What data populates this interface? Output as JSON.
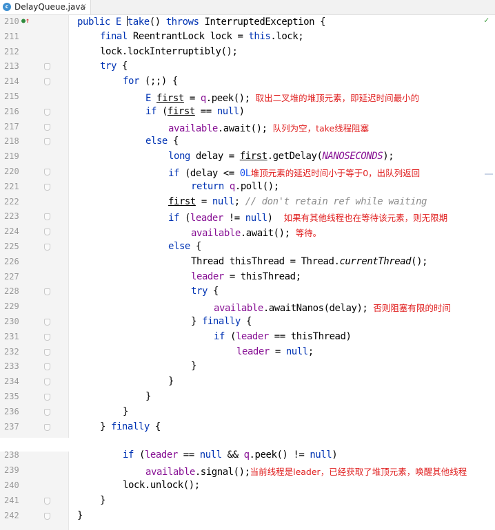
{
  "tab": {
    "filename": "DelayQueue.java",
    "close": "×",
    "icon": "class-icon",
    "icon_letter": "c"
  },
  "status": {
    "check": "✓"
  },
  "lines": [
    {
      "n": "210",
      "indent": 0,
      "mark": true,
      "segs": [
        [
          "kw",
          "public "
        ],
        [
          "kw",
          "E "
        ],
        [
          "cursor",
          ""
        ],
        [
          "kw",
          "take"
        ],
        [
          "",
          "() "
        ],
        [
          "kw",
          "throws "
        ],
        [
          "",
          "InterruptedException {"
        ]
      ]
    },
    {
      "n": "211",
      "indent": 1,
      "segs": [
        [
          "kw",
          "final "
        ],
        [
          "",
          "ReentrantLock lock = "
        ],
        [
          "kw",
          "this"
        ],
        [
          "",
          ".lock;"
        ]
      ]
    },
    {
      "n": "212",
      "indent": 1,
      "segs": [
        [
          "",
          "lock.lockInterruptibly();"
        ]
      ]
    },
    {
      "n": "213",
      "indent": 1,
      "fold": true,
      "segs": [
        [
          "kw",
          "try "
        ],
        [
          "",
          "{"
        ]
      ]
    },
    {
      "n": "214",
      "indent": 2,
      "fold": true,
      "segs": [
        [
          "kw",
          "for "
        ],
        [
          "",
          "(;;) {"
        ]
      ]
    },
    {
      "n": "215",
      "indent": 3,
      "segs": [
        [
          "kw",
          "E "
        ],
        [
          "ul",
          "first"
        ],
        [
          "",
          " = "
        ],
        [
          "fld",
          "q"
        ],
        [
          "",
          ".peek(); "
        ],
        [
          "ann",
          "取出二叉堆的堆顶元素，即延迟时间最小的"
        ]
      ]
    },
    {
      "n": "216",
      "indent": 3,
      "fold": true,
      "segs": [
        [
          "kw",
          "if "
        ],
        [
          "",
          "("
        ],
        [
          "ul",
          "first"
        ],
        [
          "",
          " == "
        ],
        [
          "kw",
          "null"
        ],
        [
          "",
          ")"
        ]
      ]
    },
    {
      "n": "217",
      "indent": 4,
      "fold": true,
      "segs": [
        [
          "fld",
          "available"
        ],
        [
          "",
          ".await(); "
        ],
        [
          "ann",
          "队列为空，take线程阻塞"
        ]
      ]
    },
    {
      "n": "218",
      "indent": 3,
      "fold": true,
      "segs": [
        [
          "kw",
          "else "
        ],
        [
          "",
          "{"
        ]
      ]
    },
    {
      "n": "219",
      "indent": 4,
      "segs": [
        [
          "kw",
          "long "
        ],
        [
          "",
          "delay = "
        ],
        [
          "ul",
          "first"
        ],
        [
          "",
          ".getDelay("
        ],
        [
          "cst",
          "NANOSECONDS"
        ],
        [
          "",
          ");"
        ]
      ]
    },
    {
      "n": "220",
      "indent": 4,
      "fold": true,
      "segs": [
        [
          "kw",
          "if "
        ],
        [
          "",
          "(delay <= "
        ],
        [
          "num",
          "0L"
        ],
        [
          ") "
        ],
        [
          "ann",
          "堆顶元素的延迟时间小于等于0，出队列返回"
        ]
      ]
    },
    {
      "n": "221",
      "indent": 5,
      "fold": true,
      "segs": [
        [
          "kw",
          "return "
        ],
        [
          "fld",
          "q"
        ],
        [
          "",
          ".poll();"
        ]
      ]
    },
    {
      "n": "222",
      "indent": 4,
      "segs": [
        [
          "ul",
          "first"
        ],
        [
          "",
          " = "
        ],
        [
          "kw",
          "null"
        ],
        [
          "",
          "; "
        ],
        [
          "cmt",
          "// don't retain ref while waiting"
        ]
      ]
    },
    {
      "n": "223",
      "indent": 4,
      "fold": true,
      "segs": [
        [
          "kw",
          "if "
        ],
        [
          "",
          "("
        ],
        [
          "fld",
          "leader"
        ],
        [
          "",
          " != "
        ],
        [
          "kw",
          "null"
        ],
        [
          "",
          ")  "
        ],
        [
          "ann",
          "如果有其他线程也在等待该元素，则无限期"
        ]
      ]
    },
    {
      "n": "224",
      "indent": 5,
      "fold": true,
      "segs": [
        [
          "fld",
          "available"
        ],
        [
          "",
          ".await(); "
        ],
        [
          "ann",
          "等待。"
        ]
      ]
    },
    {
      "n": "225",
      "indent": 4,
      "fold": true,
      "segs": [
        [
          "kw",
          "else "
        ],
        [
          "",
          "{"
        ]
      ]
    },
    {
      "n": "226",
      "indent": 5,
      "segs": [
        [
          "",
          "Thread thisThread = Thread."
        ],
        [
          "ital",
          "currentThread"
        ],
        [
          "",
          "();"
        ]
      ]
    },
    {
      "n": "227",
      "indent": 5,
      "segs": [
        [
          "fld",
          "leader"
        ],
        [
          "",
          " = thisThread;"
        ]
      ]
    },
    {
      "n": "228",
      "indent": 5,
      "fold": true,
      "segs": [
        [
          "kw",
          "try "
        ],
        [
          "",
          "{"
        ]
      ]
    },
    {
      "n": "229",
      "indent": 6,
      "segs": [
        [
          "fld",
          "available"
        ],
        [
          "",
          ".awaitNanos(delay); "
        ],
        [
          "ann",
          "否则阻塞有限的时间"
        ]
      ]
    },
    {
      "n": "230",
      "indent": 5,
      "fold": true,
      "segs": [
        [
          "",
          "} "
        ],
        [
          "kw",
          "finally "
        ],
        [
          "",
          "{"
        ]
      ]
    },
    {
      "n": "231",
      "indent": 6,
      "fold": true,
      "segs": [
        [
          "kw",
          "if "
        ],
        [
          "",
          "("
        ],
        [
          "fld",
          "leader"
        ],
        [
          "",
          " == thisThread)"
        ]
      ]
    },
    {
      "n": "232",
      "indent": 7,
      "fold": true,
      "segs": [
        [
          "fld",
          "leader"
        ],
        [
          "",
          " = "
        ],
        [
          "kw",
          "null"
        ],
        [
          "",
          ";"
        ]
      ]
    },
    {
      "n": "233",
      "indent": 5,
      "fold": true,
      "segs": [
        [
          "",
          "}"
        ]
      ]
    },
    {
      "n": "234",
      "indent": 4,
      "fold": true,
      "segs": [
        [
          "",
          "}"
        ]
      ]
    },
    {
      "n": "235",
      "indent": 3,
      "fold": true,
      "segs": [
        [
          "",
          "}"
        ]
      ]
    },
    {
      "n": "236",
      "indent": 2,
      "fold": true,
      "segs": [
        [
          "",
          "}"
        ]
      ]
    },
    {
      "n": "237",
      "indent": 1,
      "fold": true,
      "segs": [
        [
          "",
          "} "
        ],
        [
          "kw",
          "finally "
        ],
        [
          "",
          "{"
        ]
      ]
    },
    {
      "n": "238",
      "indent": 2,
      "gap": true,
      "segs": [
        [
          "kw",
          "if "
        ],
        [
          "",
          "("
        ],
        [
          "fld",
          "leader"
        ],
        [
          "",
          " == "
        ],
        [
          "kw",
          "null "
        ],
        [
          "",
          "&& "
        ],
        [
          "fld",
          "q"
        ],
        [
          "",
          ".peek() != "
        ],
        [
          "kw",
          "null"
        ],
        [
          "",
          ")"
        ]
      ]
    },
    {
      "n": "239",
      "indent": 3,
      "segs": [
        [
          "fld",
          "available"
        ],
        [
          "",
          ".signal();"
        ],
        [
          "ann",
          "当前线程是leader，已经获取了堆顶元素，唤醒其他线程"
        ]
      ]
    },
    {
      "n": "240",
      "indent": 2,
      "segs": [
        [
          "",
          "lock.unlock();"
        ]
      ]
    },
    {
      "n": "241",
      "indent": 1,
      "fold": true,
      "segs": [
        [
          "",
          "}"
        ]
      ]
    },
    {
      "n": "242",
      "indent": 0,
      "fold": true,
      "segs": [
        [
          "",
          "}"
        ]
      ]
    }
  ]
}
